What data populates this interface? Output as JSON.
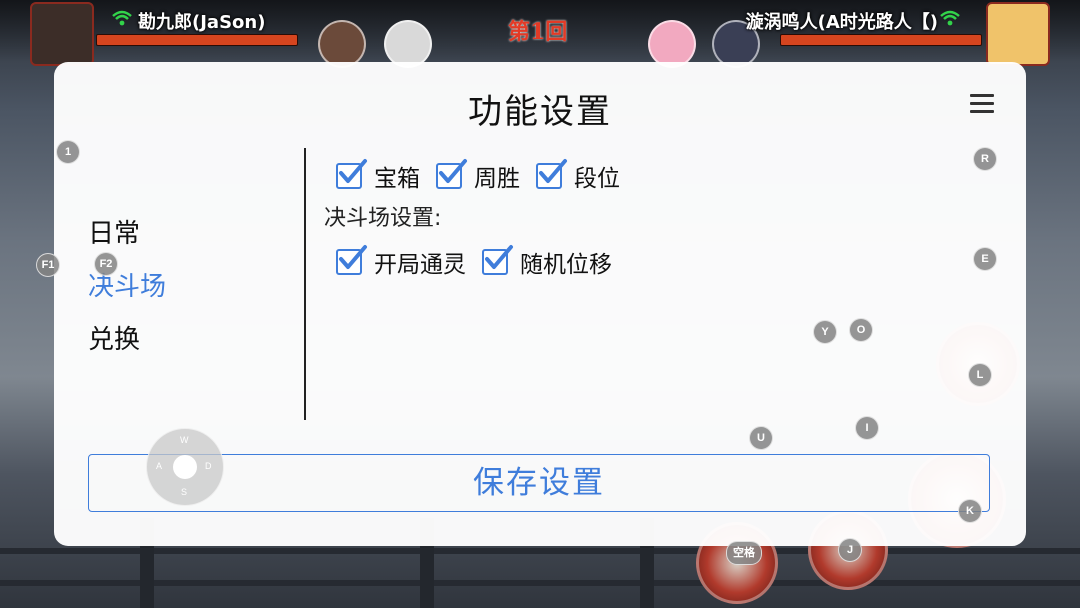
{
  "hud": {
    "player_left_name": "勘九郎(JaSon)",
    "player_right_name": "漩涡鸣人(A时光路人【)",
    "round_label": "第1回"
  },
  "modal": {
    "title": "功能设置",
    "nav_items": [
      {
        "label": "日常",
        "active": false
      },
      {
        "label": "决斗场",
        "active": true
      },
      {
        "label": "兑换",
        "active": false
      }
    ],
    "daily_options": [
      {
        "label": "宝箱",
        "checked": true
      },
      {
        "label": "周胜",
        "checked": true
      },
      {
        "label": "段位",
        "checked": true
      }
    ],
    "arena_section_label": "决斗场设置:",
    "arena_options": [
      {
        "label": "开局通灵",
        "checked": true
      },
      {
        "label": "随机位移",
        "checked": true
      }
    ],
    "save_button_label": "保存设置"
  },
  "key_hints": {
    "k1": "1",
    "f1": "F1",
    "f2": "F2",
    "r": "R",
    "e": "E",
    "y": "Y",
    "o": "O",
    "l": "L",
    "u": "U",
    "i": "I",
    "k": "K",
    "j": "J",
    "space": "空格"
  },
  "joystick": {
    "up": "W",
    "left": "A",
    "down": "S",
    "right": "D"
  },
  "colors": {
    "accent": "#3f7ddb",
    "hp": "#d6451f",
    "round": "#e33a26"
  }
}
